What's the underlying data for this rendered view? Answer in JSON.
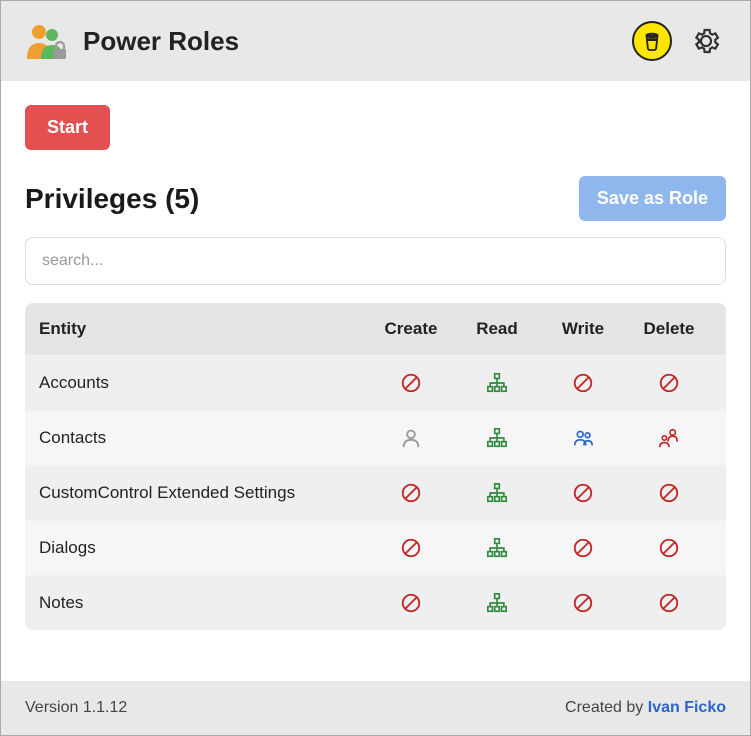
{
  "header": {
    "title": "Power Roles"
  },
  "buttons": {
    "start": "Start",
    "save_as_role": "Save as Role"
  },
  "section": {
    "title": "Privileges (5)"
  },
  "search": {
    "placeholder": "search..."
  },
  "table": {
    "headers": {
      "entity": "Entity",
      "create": "Create",
      "read": "Read",
      "write": "Write",
      "delete": "Delete"
    },
    "rows": [
      {
        "entity": "Accounts",
        "create": "none",
        "read": "org",
        "write": "none",
        "delete": "none"
      },
      {
        "entity": "Contacts",
        "create": "user",
        "read": "org",
        "write": "bu",
        "delete": "parent"
      },
      {
        "entity": "CustomControl Extended Settings",
        "create": "none",
        "read": "org",
        "write": "none",
        "delete": "none"
      },
      {
        "entity": "Dialogs",
        "create": "none",
        "read": "org",
        "write": "none",
        "delete": "none"
      },
      {
        "entity": "Notes",
        "create": "none",
        "read": "org",
        "write": "none",
        "delete": "none"
      }
    ]
  },
  "footer": {
    "version": "Version 1.1.12",
    "created_by_label": "Created by ",
    "author": "Ivan Ficko"
  },
  "privilege_icons": {
    "none": {
      "label": "None",
      "color": "#c22626"
    },
    "user": {
      "label": "User",
      "color": "#9a9a9a"
    },
    "bu": {
      "label": "Business Unit",
      "color": "#2a66c8"
    },
    "parent": {
      "label": "Parent: Child BU",
      "color": "#c22626"
    },
    "org": {
      "label": "Organization",
      "color": "#2e8b3d"
    }
  }
}
